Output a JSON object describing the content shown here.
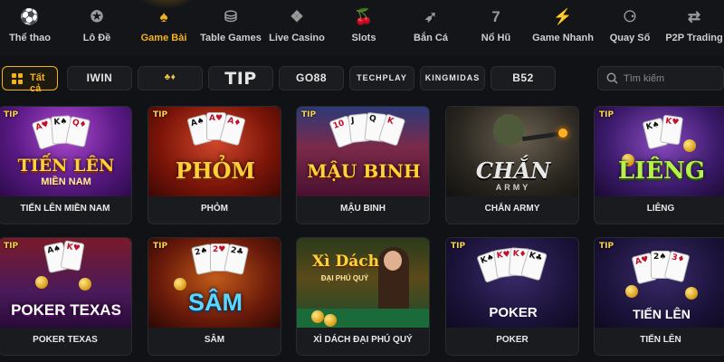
{
  "nav": {
    "items": [
      {
        "label": "Thể thao",
        "icon": "soccer-ball-icon",
        "glyph": "⚽"
      },
      {
        "label": "Lô Đề",
        "icon": "lottery-wheel-icon",
        "glyph": "✪"
      },
      {
        "label": "Game Bài",
        "icon": "cards-icon",
        "glyph": "♠",
        "active": true
      },
      {
        "label": "Table Games",
        "icon": "chips-icon",
        "glyph": "⛁"
      },
      {
        "label": "Live Casino",
        "icon": "diamond-icon",
        "glyph": "❖"
      },
      {
        "label": "Slots",
        "icon": "cherry-icon",
        "glyph": "🍒"
      },
      {
        "label": "Bắn Cá",
        "icon": "fish-icon",
        "glyph": "➶"
      },
      {
        "label": "Nổ Hũ",
        "icon": "seven-icon",
        "glyph": "7"
      },
      {
        "label": "Game Nhanh",
        "icon": "lightning-icon",
        "glyph": "⚡"
      },
      {
        "label": "Quay Số",
        "icon": "lottery-balls-icon",
        "glyph": "⚆"
      },
      {
        "label": "P2P Trading",
        "icon": "p2p-trading-icon",
        "glyph": "⇄"
      }
    ]
  },
  "filters": {
    "all_label": "Tất cả",
    "providers": [
      "IWIN",
      "",
      "TIP",
      "GO88",
      "TECHPLAY",
      "KINGMIDAS",
      "B52"
    ]
  },
  "search": {
    "placeholder": "Tìm kiếm"
  },
  "colors": {
    "accent": "#f6b21a",
    "background": "#111215",
    "card": "#1a1b1e"
  },
  "games": [
    {
      "title": "TIẾN LÊN MIỀN NAM",
      "art_title": "TIẾN LÊN",
      "art_sub": "MIỀN NAM",
      "badge": "TIP",
      "icon": "tien-len-art"
    },
    {
      "title": "PHỎM",
      "art_title": "PHỎM",
      "art_sub": "",
      "badge": "TIP",
      "icon": "phom-art"
    },
    {
      "title": "MẬU BINH",
      "art_title": "MẬU BINH",
      "art_sub": "",
      "badge": "TIP",
      "icon": "mau-binh-art"
    },
    {
      "title": "CHẮN ARMY",
      "art_title": "CHẮN",
      "art_sub": "ARMY",
      "badge": "",
      "icon": "chan-army-art"
    },
    {
      "title": "LIÊNG",
      "art_title": "LIÊNG",
      "art_sub": "",
      "badge": "TIP",
      "icon": "lieng-art"
    },
    {
      "title": "POKER TEXAS",
      "art_title": "POKER TEXAS",
      "art_sub": "",
      "badge": "TIP",
      "icon": "poker-texas-art"
    },
    {
      "title": "SÂM",
      "art_title": "SÂM",
      "art_sub": "",
      "badge": "TIP",
      "icon": "sam-art"
    },
    {
      "title": "XÌ DÁCH ĐẠI PHÚ QUÝ",
      "art_title": "Xì Dách",
      "art_sub": "ĐẠI PHÚ QUÝ",
      "badge": "",
      "icon": "xi-dach-art"
    },
    {
      "title": "POKER",
      "art_title": "POKER",
      "art_sub": "",
      "badge": "TIP",
      "icon": "poker-art"
    },
    {
      "title": "TIẾN LÊN",
      "art_title": "TIẾN LÊN",
      "art_sub": "",
      "badge": "TIP",
      "icon": "tien-len-tip-art"
    }
  ]
}
